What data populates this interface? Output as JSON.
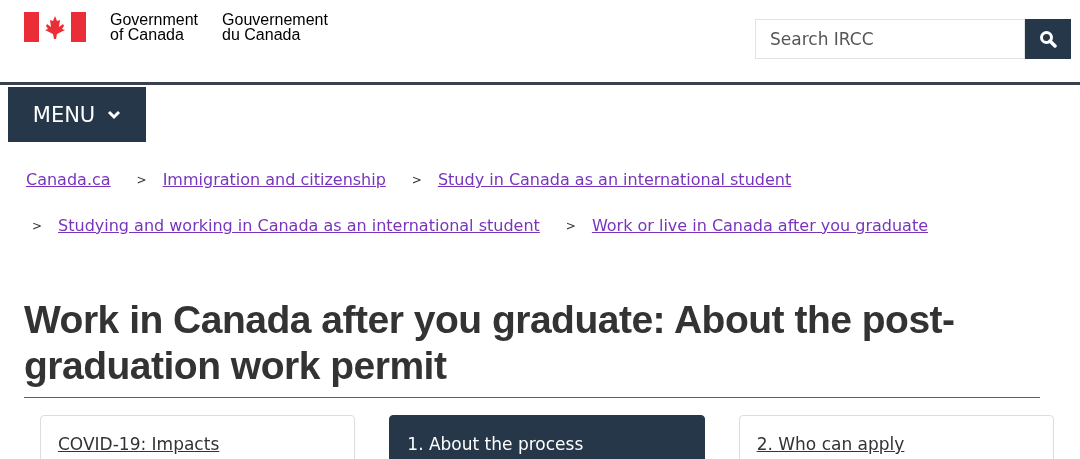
{
  "header": {
    "government_en": [
      "Government",
      "of Canada"
    ],
    "government_fr": [
      "Gouvernement",
      "du Canada"
    ],
    "search": {
      "placeholder": "Search IRCC"
    }
  },
  "menu": {
    "label": "MENU"
  },
  "breadcrumbs": [
    {
      "label": "Canada.ca"
    },
    {
      "label": "Immigration and citizenship",
      "separator": ">"
    },
    {
      "label": "Study in Canada as an international student",
      "separator": ">"
    },
    {
      "label": "Studying and working in Canada as an international student",
      "separator": ">"
    },
    {
      "label": "Work or live in Canada after you graduate",
      "separator": ">"
    }
  ],
  "title": "Work in Canada after you graduate: About the post-graduation work permit",
  "steps": [
    {
      "label": "COVID-19: Impacts",
      "selected": false
    },
    {
      "label": "1. About the process",
      "selected": true
    },
    {
      "label": "2. Who can apply",
      "selected": false
    }
  ]
}
